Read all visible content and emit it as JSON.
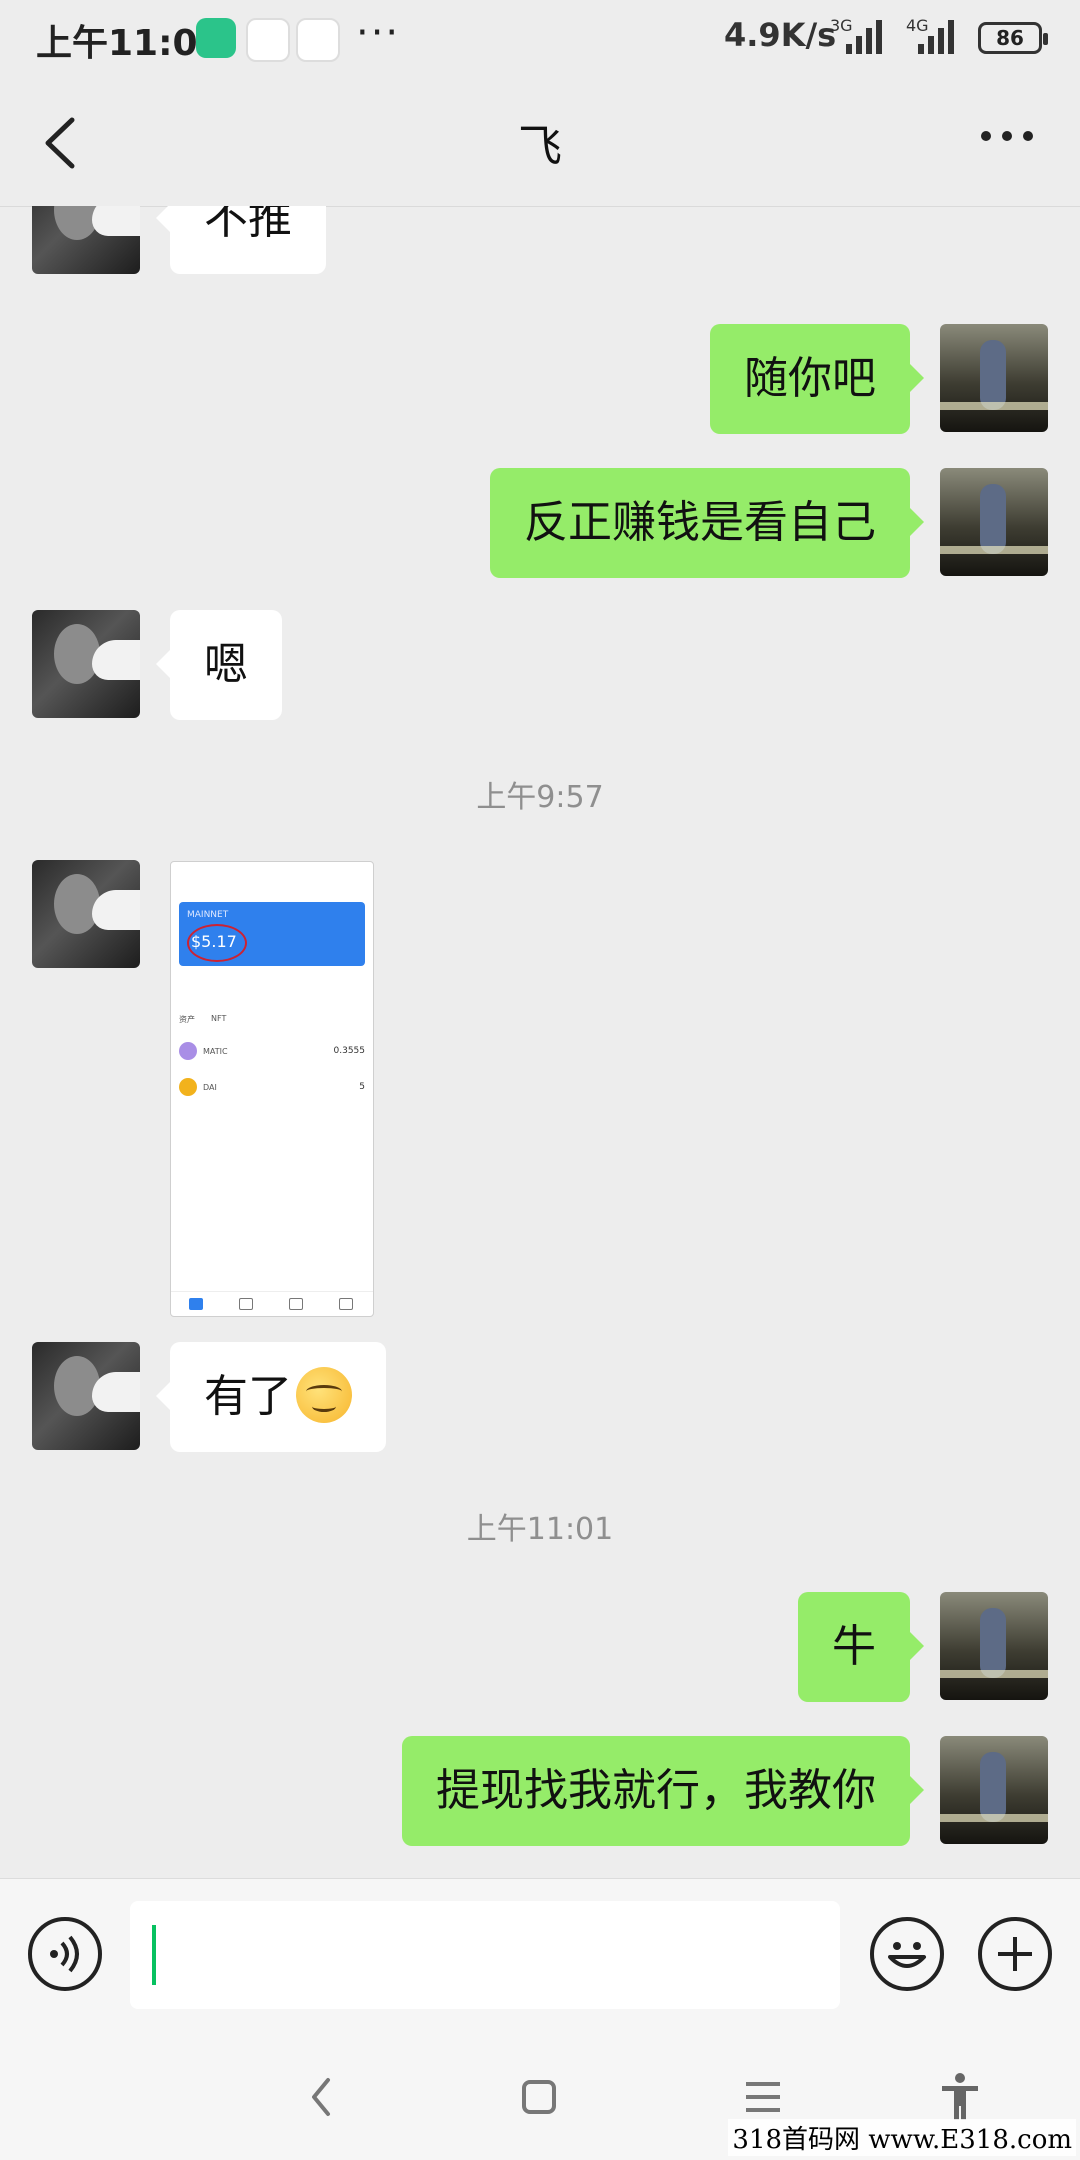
{
  "status_bar": {
    "time": "上午11:01",
    "more": "···",
    "net_speed": "4.9K/s",
    "net1": "3G",
    "net2": "4G",
    "battery": "86"
  },
  "header": {
    "back_icon": "chevron-left-icon",
    "title": "飞",
    "more_icon": "more-horizontal-icon"
  },
  "messages": [
    {
      "side": "left",
      "type": "text",
      "text": "不推"
    },
    {
      "side": "right",
      "type": "text",
      "text": "随你吧"
    },
    {
      "side": "right",
      "type": "text",
      "text": "反正赚钱是看自己"
    },
    {
      "side": "left",
      "type": "text",
      "text": "嗯"
    },
    {
      "type": "time",
      "text": "上午9:57"
    },
    {
      "side": "left",
      "type": "image",
      "image": {
        "wallet_label": "MAINNET",
        "amount": "$5.17",
        "tab_assets": "资产",
        "tab_nft": "NFT",
        "assets": [
          {
            "name": "MATIC",
            "value": "0.3555"
          },
          {
            "name": "DAI",
            "value": "5"
          }
        ]
      }
    },
    {
      "side": "left",
      "type": "text",
      "text": "有了",
      "emoji": "smirk-emoji"
    },
    {
      "type": "time",
      "text": "上午11:01"
    },
    {
      "side": "right",
      "type": "text",
      "text": "牛"
    },
    {
      "side": "right",
      "type": "text",
      "text": "提现找我就行，我教你"
    }
  ],
  "input_bar": {
    "voice_icon": "voice-icon",
    "emoji_icon": "smiley-icon",
    "plus_icon": "plus-circle-icon",
    "value": ""
  },
  "nav_bar": {
    "icons": [
      "nav-back-icon",
      "nav-home-icon",
      "nav-menu-icon",
      "accessibility-icon"
    ]
  },
  "watermark": "318首码网 www.E318.com",
  "colors": {
    "background": "#ededed",
    "bubble_right": "#95ec69",
    "bubble_left": "#ffffff",
    "cursor": "#07c160"
  }
}
